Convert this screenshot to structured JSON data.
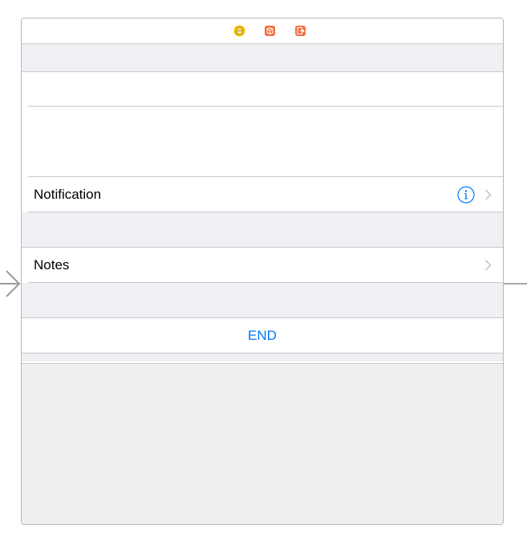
{
  "dock": {
    "icons": [
      "view-controller-icon",
      "first-responder-icon",
      "exit-icon"
    ],
    "colors": {
      "view_controller": "#f5c000",
      "first_responder": "#f07040",
      "exit": "#f07040"
    }
  },
  "table": {
    "notification_label": "Notification",
    "notes_label": "Notes",
    "end_label": "END"
  },
  "colors": {
    "accent": "#007aff",
    "group_background": "#efeff4",
    "separator": "#c8c7cc"
  }
}
